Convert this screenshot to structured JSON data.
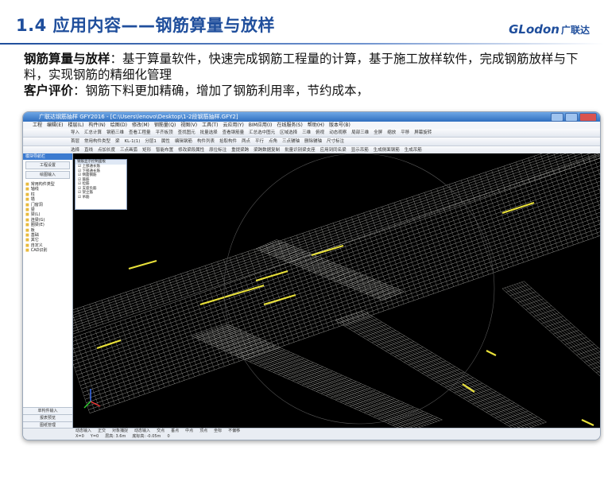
{
  "slide": {
    "title": "1.4 应用内容——钢筋算量与放样",
    "logo": "GLodon",
    "logo_cn": "广联达"
  },
  "paragraphs": {
    "p1_bold": "钢筋算量与放样",
    "p1_rest": "：基于算量软件，快速完成钢筋工程量的计算，基于施工放样软件，完成钢筋放样与下料，实现钢筋的精细化管理",
    "p2_bold": "客户评价",
    "p2_rest": "：钢筋下料更加精确，增加了钢筋利用率，节约成本，"
  },
  "app": {
    "window_title": "广联达钢筋抽样 GFY2016 - [C:\\Users\\lenovo\\Desktop\\1-2段钢筋抽样.GFY2]",
    "menu": [
      "工程",
      "编辑(E)",
      "楼层(L)",
      "构件(N)",
      "绘图(D)",
      "修改(M)",
      "钢筋量(Q)",
      "视图(V)",
      "工具(T)",
      "云应用(Y)",
      "BIM应用(I)",
      "在线服务(S)",
      "帮助(H)",
      "版本号(B)"
    ],
    "toolbar1": [
      "导入",
      "汇总计算",
      "钢筋三维",
      "查看工程量",
      "平齐板顶",
      "查找图元",
      "批量选择",
      "查看钢筋量",
      "汇总选中图元",
      "区域选择",
      "三维",
      "俯视",
      "动态观察",
      "局部三维",
      "全屏",
      "缩放",
      "平移",
      "屏幕旋转"
    ],
    "toolbar2": [
      "首层",
      "常用构件类型",
      "梁",
      "KL-1(1)",
      "分层1",
      "属性",
      "编辑钢筋",
      "构件列表",
      "拾取构件",
      "两点",
      "平行",
      "点角",
      "三点辅轴",
      "删除辅轴",
      "尺寸标注"
    ],
    "toolbar3": [
      "选择",
      "直线",
      "点加长度",
      "三点画弧",
      "矩形",
      "智能布置",
      "修改梁段属性",
      "原位标注",
      "重提梁跨",
      "梁跨数据复制",
      "批量识别梁支座",
      "应用到同名梁",
      "显示吊筋",
      "生成侧面钢筋",
      "生成吊筋"
    ],
    "left_panel": {
      "header": "模块导航栏",
      "btn1": "工程设置",
      "btn2": "绘图输入",
      "tree": [
        "常用构件类型",
        "轴线",
        "柱",
        "墙",
        "门窗洞",
        "梁",
        "梁(L)",
        "连梁(G)",
        "圈梁(E)",
        "板",
        "基础",
        "其它",
        "自定义",
        "CAD识别"
      ],
      "bottom": [
        "单构件输入",
        "报表预览",
        "图纸管理"
      ]
    },
    "floating_window": {
      "header": "钢筋显示控制面板",
      "items": [
        "上部通长筋",
        "下部通长筋",
        "侧面钢筋",
        "箍筋",
        "拉筋",
        "支座负筋",
        "架立筋",
        "吊筋"
      ]
    },
    "statusbar": {
      "row1": [
        "动态输入",
        "正交",
        "对象捕捉",
        "动态输入",
        "交点",
        "垂点",
        "中点",
        "顶点",
        "坐标",
        "不偏移"
      ],
      "row2": [
        "X=0",
        "Y=0",
        "层高: 3.6m",
        "底标高: -0.05m",
        "0"
      ]
    }
  },
  "colors": {
    "title_blue": "#1f4e9c",
    "rebar_gray": "#c9c9c4",
    "rebar_highlight": "#e8e03a",
    "viewport_bg": "#000000"
  }
}
